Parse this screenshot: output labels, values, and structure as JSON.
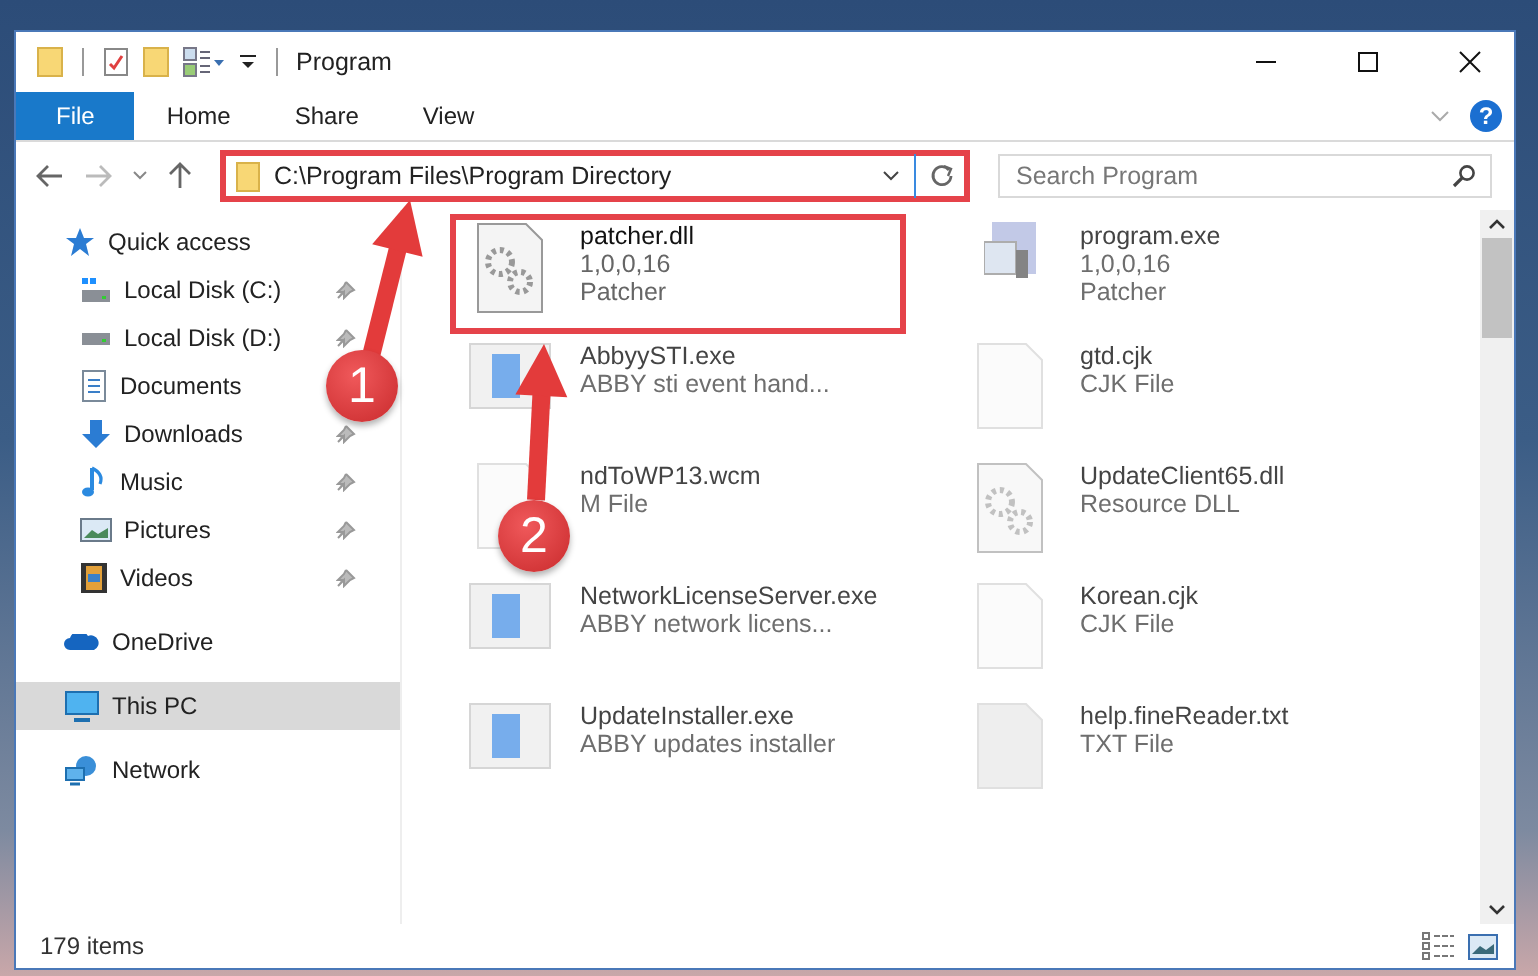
{
  "window": {
    "title": "Program",
    "help": "?"
  },
  "ribbon_tabs": [
    {
      "label": "File",
      "selected": true
    },
    {
      "label": "Home",
      "selected": false
    },
    {
      "label": "Share",
      "selected": false
    },
    {
      "label": "View",
      "selected": false
    }
  ],
  "address_bar": {
    "path": "C:\\Program Files\\Program Directory",
    "highlighted": true
  },
  "search": {
    "placeholder": "Search Program"
  },
  "sidebar": {
    "items": [
      {
        "label": "Quick access",
        "kind": "star",
        "selected": false,
        "children": [
          {
            "label": "Local Disk (C:)",
            "kind": "drive-c",
            "pinned": true,
            "selected": false
          },
          {
            "label": "Local Disk (D:)",
            "kind": "drive",
            "pinned": true,
            "selected": false
          },
          {
            "label": "Documents",
            "kind": "documents",
            "selected": false
          },
          {
            "label": "Downloads",
            "kind": "downloads",
            "pinned": true,
            "selected": false
          },
          {
            "label": "Music",
            "kind": "music",
            "pinned": true,
            "selected": false
          },
          {
            "label": "Pictures",
            "kind": "pictures",
            "pinned": true,
            "selected": false
          },
          {
            "label": "Videos",
            "kind": "videos",
            "pinned": true,
            "selected": false
          }
        ]
      },
      {
        "label": "OneDrive",
        "kind": "cloud",
        "selected": false
      },
      {
        "label": "This PC",
        "kind": "pc",
        "selected": true
      },
      {
        "label": "Network",
        "kind": "network",
        "selected": false
      }
    ]
  },
  "files": [
    {
      "name": "patcher.dll",
      "details": [
        "1,0,0,16",
        "Patcher"
      ],
      "kind": "gear-doc",
      "highlighted": true,
      "dimmed": false
    },
    {
      "name": "program.exe",
      "details": [
        "1,0,0,16",
        "Patcher"
      ],
      "kind": "program",
      "highlighted": false,
      "dimmed": true
    },
    {
      "name": "AbbyySTI.exe",
      "details": [
        "ABBY sti event hand..."
      ],
      "kind": "app",
      "highlighted": false,
      "dimmed": true
    },
    {
      "name": "gtd.cjk",
      "details": [
        "CJK File"
      ],
      "kind": "blank",
      "highlighted": false,
      "dimmed": true
    },
    {
      "name": "ndToWP13.wcm",
      "details": [
        "M File"
      ],
      "kind": "blank",
      "highlighted": false,
      "dimmed": true
    },
    {
      "name": "UpdateClient65.dll",
      "details": [
        "Resource DLL"
      ],
      "kind": "gear-doc",
      "highlighted": false,
      "dimmed": true
    },
    {
      "name": "NetworkLicenseServer.exe",
      "details": [
        "ABBY network licens..."
      ],
      "kind": "app",
      "highlighted": false,
      "dimmed": true
    },
    {
      "name": "Korean.cjk",
      "details": [
        "CJK File"
      ],
      "kind": "blank",
      "highlighted": false,
      "dimmed": true
    },
    {
      "name": "UpdateInstaller.exe",
      "details": [
        "ABBY updates installer"
      ],
      "kind": "app",
      "highlighted": false,
      "dimmed": true
    },
    {
      "name": "help.fineReader.txt",
      "details": [
        "TXT File"
      ],
      "kind": "text",
      "highlighted": false,
      "dimmed": true
    }
  ],
  "status_bar": {
    "count": "179 items"
  },
  "callouts": [
    {
      "number": "1"
    },
    {
      "number": "2"
    }
  ]
}
